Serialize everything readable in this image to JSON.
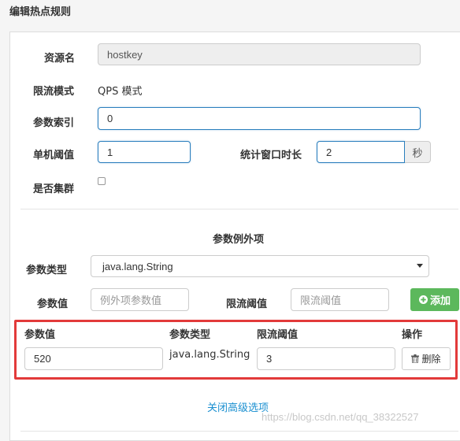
{
  "page": {
    "title": "编辑热点规则"
  },
  "form": {
    "resource_label": "资源名",
    "resource_value": "hostkey",
    "mode_label": "限流模式",
    "mode_value": "QPS 模式",
    "param_index_label": "参数索引",
    "param_index_value": "0",
    "threshold_label": "单机阈值",
    "threshold_value": "1",
    "window_label": "统计窗口时长",
    "window_value": "2",
    "window_unit": "秒",
    "cluster_label": "是否集群",
    "cluster_checked": false
  },
  "exceptions": {
    "section_title": "参数例外项",
    "type_label": "参数类型",
    "type_selected": "java.lang.String",
    "value_label": "参数值",
    "value_placeholder": "例外项参数值",
    "limit_label": "限流阈值",
    "limit_placeholder": "限流阈值",
    "add_button": "添加",
    "add_icon": "plus-icon",
    "table": {
      "headers": [
        "参数值",
        "参数类型",
        "限流阈值",
        "操作"
      ],
      "rows": [
        {
          "value": "520",
          "type": "java.lang.String",
          "limit": "3",
          "delete_label": "删除",
          "delete_icon": "trash-icon"
        }
      ]
    }
  },
  "footer": {
    "toggle_link": "关闭高级选项",
    "watermark": "https://blog.csdn.net/qq_38322527"
  },
  "colors": {
    "accent": "#2a7ebd",
    "add_button": "#5cb85c",
    "highlight_border": "#e23a3a",
    "link": "#1a8fd0"
  }
}
